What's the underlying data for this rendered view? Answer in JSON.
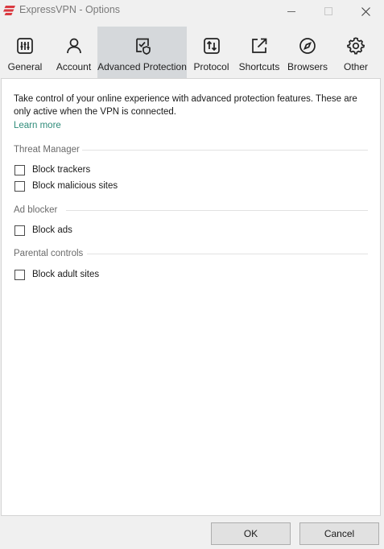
{
  "window": {
    "title": "ExpressVPN - Options",
    "brand_color": "#da3940"
  },
  "tabs": [
    {
      "label": "General",
      "icon": "sliders-icon",
      "active": false
    },
    {
      "label": "Account",
      "icon": "person-icon",
      "active": false
    },
    {
      "label": "Advanced Protection",
      "icon": "shield-check-icon",
      "active": true
    },
    {
      "label": "Protocol",
      "icon": "protocol-icon",
      "active": false
    },
    {
      "label": "Shortcuts",
      "icon": "external-link-icon",
      "active": false
    },
    {
      "label": "Browsers",
      "icon": "compass-icon",
      "active": false
    },
    {
      "label": "Other",
      "icon": "gear-icon",
      "active": false
    }
  ],
  "content": {
    "intro": "Take control of your online experience with advanced protection features. These are only active when the VPN is connected.",
    "learn_more": "Learn more",
    "link_color": "#2f8c7a",
    "sections": [
      {
        "title": "Threat Manager",
        "options": [
          {
            "label": "Block trackers",
            "checked": false
          },
          {
            "label": "Block malicious sites",
            "checked": false
          }
        ]
      },
      {
        "title": "Ad blocker",
        "options": [
          {
            "label": "Block ads",
            "checked": false
          }
        ]
      },
      {
        "title": "Parental controls",
        "options": [
          {
            "label": "Block adult sites",
            "checked": false
          }
        ]
      }
    ]
  },
  "footer": {
    "ok_label": "OK",
    "cancel_label": "Cancel"
  }
}
